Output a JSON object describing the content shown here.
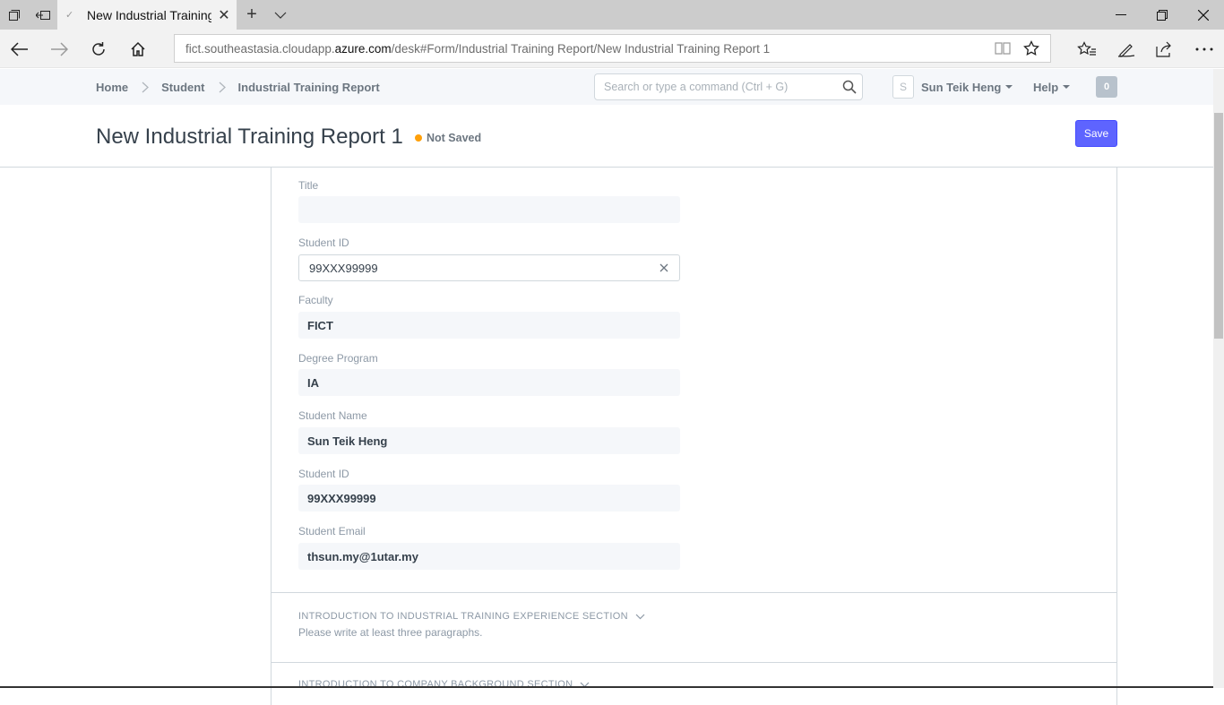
{
  "browser": {
    "tab_title": "New Industrial Training",
    "url_prefix": "fict.southeastasia.cloudapp.",
    "url_domain": "azure.com",
    "url_path": "/desk#Form/Industrial Training Report/New Industrial Training Report 1"
  },
  "appbar": {
    "breadcrumbs": [
      "Home",
      "Student",
      "Industrial Training Report"
    ],
    "search_placeholder": "Search or type a command (Ctrl + G)",
    "avatar_initial": "S",
    "user_name": "Sun Teik Heng",
    "help_label": "Help",
    "notification_count": "0"
  },
  "page": {
    "title": "New Industrial Training Report 1",
    "status": "Not Saved",
    "status_color": "#ffa00a",
    "save_label": "Save",
    "accent": "#5e64ff"
  },
  "form": {
    "fields": [
      {
        "label": "Title",
        "value": ""
      },
      {
        "label": "Student ID",
        "value": "99XXX99999"
      },
      {
        "label": "Faculty",
        "value": "FICT"
      },
      {
        "label": "Degree Program",
        "value": "IA"
      },
      {
        "label": "Student Name",
        "value": "Sun Teik Heng"
      },
      {
        "label": "Student ID",
        "value": "99XXX99999"
      },
      {
        "label": "Student Email",
        "value": "thsun.my@1utar.my"
      }
    ],
    "sections": [
      {
        "title": "INTRODUCTION TO INDUSTRIAL TRAINING EXPERIENCE SECTION",
        "description": "Please write at least three paragraphs."
      },
      {
        "title": "INTRODUCTION TO COMPANY BACKGROUND SECTION"
      }
    ]
  }
}
